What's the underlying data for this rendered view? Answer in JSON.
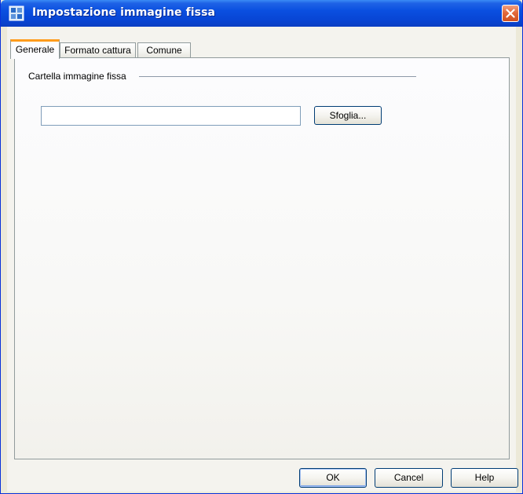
{
  "window": {
    "title": "Impostazione immagine fissa",
    "title_icon": "app-icon",
    "close_icon": "close-icon"
  },
  "tabs": [
    {
      "label": "Generale",
      "active": true
    },
    {
      "label": "Formato cattura",
      "active": false
    },
    {
      "label": "Comune",
      "active": false
    }
  ],
  "general": {
    "folder_group_label": "Cartella immagine fissa",
    "folder_path_value": "",
    "browse_label": "Sfoglia..."
  },
  "footer": {
    "ok_label": "OK",
    "cancel_label": "Cancel",
    "help_label": "Help"
  },
  "colors": {
    "titlebar": "#0a4fe0",
    "active_tab_accent": "#ff9c1c",
    "close_button": "#d0501f"
  }
}
